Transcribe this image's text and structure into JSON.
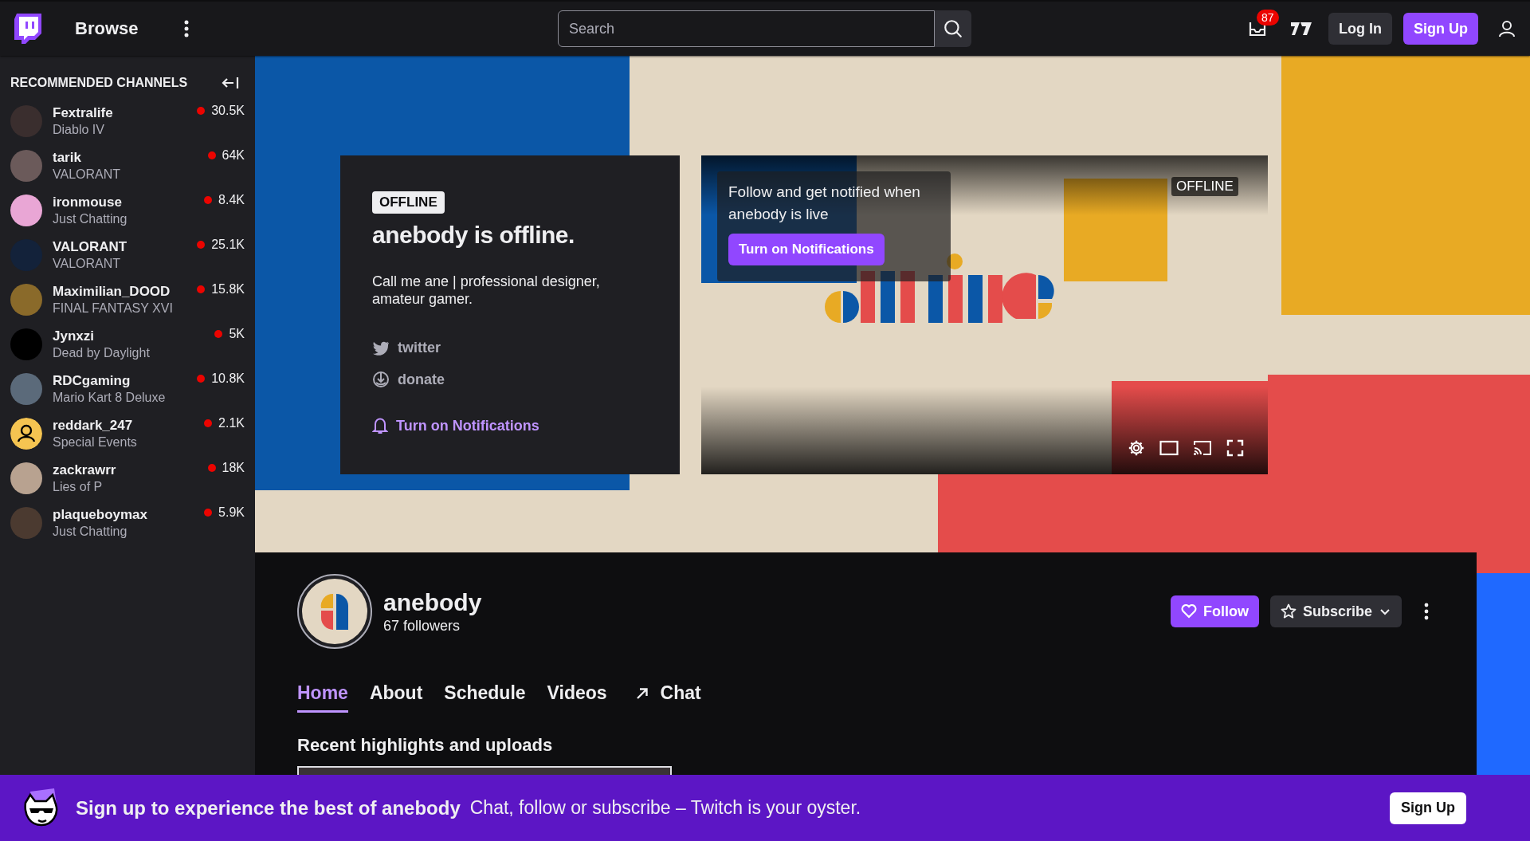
{
  "top_nav": {
    "browse": "Browse",
    "search": {
      "placeholder": "Search"
    },
    "inbox_badge": "87",
    "log_in": "Log In",
    "sign_up": "Sign Up"
  },
  "sidebar": {
    "title": "RECOMMENDED CHANNELS",
    "channels": [
      {
        "name": "Fextralife",
        "category": "Diablo IV",
        "viewers": "30.5K",
        "live": true,
        "kind": "photo"
      },
      {
        "name": "tarik",
        "category": "VALORANT",
        "viewers": "64K",
        "live": true,
        "kind": "photo"
      },
      {
        "name": "ironmouse",
        "category": "Just Chatting",
        "viewers": "8.4K",
        "live": true,
        "kind": "photo"
      },
      {
        "name": "VALORANT",
        "category": "VALORANT",
        "viewers": "25.1K",
        "live": true,
        "kind": "photo"
      },
      {
        "name": "Maximilian_DOOD",
        "category": "FINAL FANTASY XVI",
        "viewers": "15.8K",
        "live": true,
        "kind": "photo"
      },
      {
        "name": "Jynxzi",
        "category": "Dead by Daylight",
        "viewers": "5K",
        "live": true,
        "kind": "photo"
      },
      {
        "name": "RDCgaming",
        "category": "Mario Kart 8 Deluxe",
        "viewers": "10.8K",
        "live": true,
        "kind": "photo"
      },
      {
        "name": "reddark_247",
        "category": "Special Events",
        "viewers": "2.1K",
        "live": true,
        "kind": "default"
      },
      {
        "name": "zackrawrr",
        "category": "Lies of P",
        "viewers": "18K",
        "live": true,
        "kind": "photo"
      },
      {
        "name": "plaqueboymax",
        "category": "Just Chatting",
        "viewers": "5.9K",
        "live": true,
        "kind": "photo"
      }
    ]
  },
  "offline_card": {
    "badge": "OFFLINE",
    "title": "anebody is offline.",
    "description": "Call me ane | professional designer, amateur gamer.",
    "links": [
      {
        "kind": "twitter",
        "label": "twitter"
      },
      {
        "kind": "donate",
        "label": "donate"
      }
    ],
    "notify": "Turn on Notifications"
  },
  "player": {
    "prompt": "Follow and get notified when anebody is live",
    "notify_button": "Turn on Notifications",
    "badge": "OFFLINE"
  },
  "channel": {
    "name": "anebody",
    "followers": "67 followers",
    "follow": "Follow",
    "subscribe": "Subscribe",
    "tabs": [
      {
        "label": "Home",
        "selected": true,
        "kind": "page"
      },
      {
        "label": "About",
        "selected": false,
        "kind": "page"
      },
      {
        "label": "Schedule",
        "selected": false,
        "kind": "page"
      },
      {
        "label": "Videos",
        "selected": false,
        "kind": "page"
      },
      {
        "label": "Chat",
        "selected": false,
        "kind": "popout"
      }
    ],
    "section_title": "Recent highlights and uploads"
  },
  "signup_banner": {
    "headline": "Sign up to experience the best of anebody",
    "text": "Chat, follow or subscribe – Twitch is your oyster.",
    "button": "Sign Up"
  }
}
